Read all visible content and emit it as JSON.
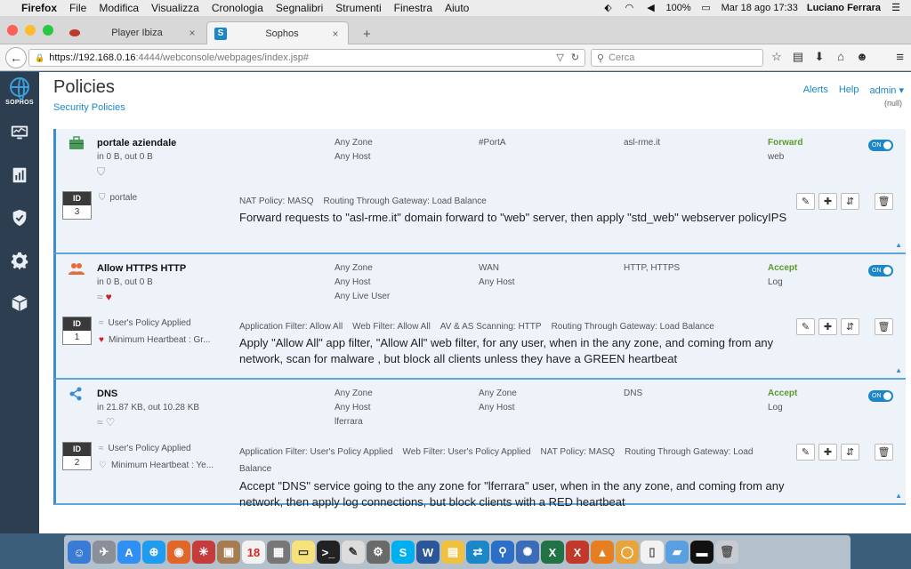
{
  "menubar": {
    "app": "Firefox",
    "items": [
      "File",
      "Modifica",
      "Visualizza",
      "Cronologia",
      "Segnalibri",
      "Strumenti",
      "Finestra",
      "Aiuto"
    ],
    "battery": "100%",
    "datetime": "Mar 18 ago  17:33",
    "user": "Luciano Ferrara"
  },
  "tabs": [
    {
      "label": "Player Ibiza",
      "close": "×",
      "favicon": ""
    },
    {
      "label": "Sophos",
      "close": "×",
      "favicon": "S"
    }
  ],
  "newtab": "+",
  "url": {
    "host": "https://192.168.0.16",
    "rest": ":4444/webconsole/webpages/index.jsp#"
  },
  "search": {
    "placeholder": "Cerca"
  },
  "sidebar": {
    "logo": "SOPHOS"
  },
  "page": {
    "title": "Policies",
    "breadcrumb": "Security Policies",
    "nav": {
      "alerts": "Alerts",
      "help": "Help",
      "admin": "admin ▾",
      "null": "(null)"
    }
  },
  "policies": [
    {
      "name": "portale aziendale",
      "traffic": "in 0 B, out 0 B",
      "col1": [
        "Any Zone",
        "Any Host"
      ],
      "col2": [
        "#PortA"
      ],
      "col3": [
        "asl-rme.it"
      ],
      "action": "Forward",
      "action_sub": "web",
      "toggle": "ON",
      "id_label": "ID",
      "id": "3",
      "sub1": "portale",
      "sub2": "",
      "details": [
        "NAT Policy: MASQ",
        "Routing Through Gateway: Load Balance"
      ],
      "summary": "Forward requests to \"asl-rme.it\" domain forward to \"web\" server, then apply \"std_web\" webserver policyIPS"
    },
    {
      "name": "Allow HTTPS HTTP",
      "traffic": "in 0 B, out 0 B",
      "col1": [
        "Any Zone",
        "Any Host",
        "Any Live User"
      ],
      "col2": [
        "WAN",
        "Any Host"
      ],
      "col3": [
        "HTTP, HTTPS"
      ],
      "action": "Accept",
      "action_sub": "Log",
      "toggle": "ON",
      "id_label": "ID",
      "id": "1",
      "sub1": "User's Policy Applied",
      "sub2": "Minimum Heartbeat : Gr...",
      "details": [
        "Application Filter: Allow All",
        "Web Filter: Allow All",
        "AV & AS Scanning: HTTP",
        "Routing Through Gateway: Load Balance"
      ],
      "summary": "Apply \"Allow All\" app filter, \"Allow All\" web filter, for any user, when in the any zone, and coming from any network, scan for malware , but block all clients unless they have a GREEN heartbeat"
    },
    {
      "name": "DNS",
      "traffic": "in 21.87 KB, out 10.28 KB",
      "col1": [
        "Any Zone",
        "Any Host",
        "lferrara"
      ],
      "col2": [
        "Any Zone",
        "Any Host"
      ],
      "col3": [
        "DNS"
      ],
      "action": "Accept",
      "action_sub": "Log",
      "toggle": "ON",
      "id_label": "ID",
      "id": "2",
      "sub1": "User's Policy Applied",
      "sub2": "Minimum Heartbeat : Ye...",
      "details": [
        "Application Filter: User's Policy Applied",
        "Web Filter: User's Policy Applied",
        "NAT Policy: MASQ",
        "Routing Through Gateway: Load Balance"
      ],
      "summary": "Accept \"DNS\" service going to the any zone for \"lferrara\" user, when in the any zone, and coming from any network, then apply log connections, but block clients with a RED heartbeat"
    }
  ],
  "colors": {
    "accent": "#1b87c9",
    "accept": "#5b9a2e",
    "sidebar": "#2c3e50",
    "row_bg": "#edf3f8"
  }
}
